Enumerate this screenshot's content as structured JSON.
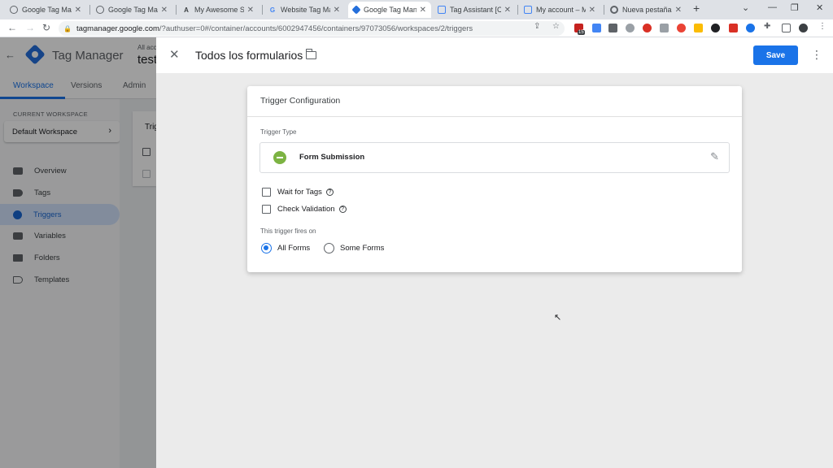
{
  "browser": {
    "tabs": [
      {
        "title": "Google Tag Mana",
        "icon": "globe-icon"
      },
      {
        "title": "Google Tag Mana",
        "icon": "globe-icon"
      },
      {
        "title": "My Awesome Sto",
        "icon": "awesome-store-icon"
      },
      {
        "title": "Website Tag Man",
        "icon": "google-icon"
      },
      {
        "title": "Google Tag Mana",
        "icon": "gtm-icon"
      },
      {
        "title": "Tag Assistant [Co",
        "icon": "tag-assistant-icon"
      },
      {
        "title": "My account – My",
        "icon": "analytics-icon"
      },
      {
        "title": "Nueva pestaña",
        "icon": "chrome-icon"
      }
    ],
    "url_host": "tagmanager.google.com",
    "url_path": "/?authuser=0#/container/accounts/6002947456/containers/97073056/workspaces/2/triggers",
    "extension_badge": "15"
  },
  "gtm": {
    "product_name": "Tag Manager",
    "account_small": "All acc",
    "account_big": "test",
    "tabs": [
      "Workspace",
      "Versions",
      "Admin"
    ],
    "current_workspace_label": "CURRENT WORKSPACE",
    "current_workspace": "Default Workspace",
    "nav": [
      {
        "label": "Overview",
        "icon": "overview-icon"
      },
      {
        "label": "Tags",
        "icon": "tag-icon"
      },
      {
        "label": "Triggers",
        "icon": "trigger-icon"
      },
      {
        "label": "Variables",
        "icon": "variables-icon"
      },
      {
        "label": "Folders",
        "icon": "folder-icon"
      },
      {
        "label": "Templates",
        "icon": "templates-icon"
      }
    ],
    "bg_card_title": "Trig"
  },
  "panel": {
    "title": "Todos los formularios",
    "save_label": "Save",
    "card_title": "Trigger Configuration",
    "trigger_type_label": "Trigger Type",
    "trigger_type": "Form Submission",
    "wait_for_tags": "Wait for Tags",
    "check_validation": "Check Validation",
    "fires_on_label": "This trigger fires on",
    "all_forms": "All Forms",
    "some_forms": "Some Forms"
  },
  "colors": {
    "accent": "#1a73e8",
    "form_submission_icon": "#7cb342"
  }
}
